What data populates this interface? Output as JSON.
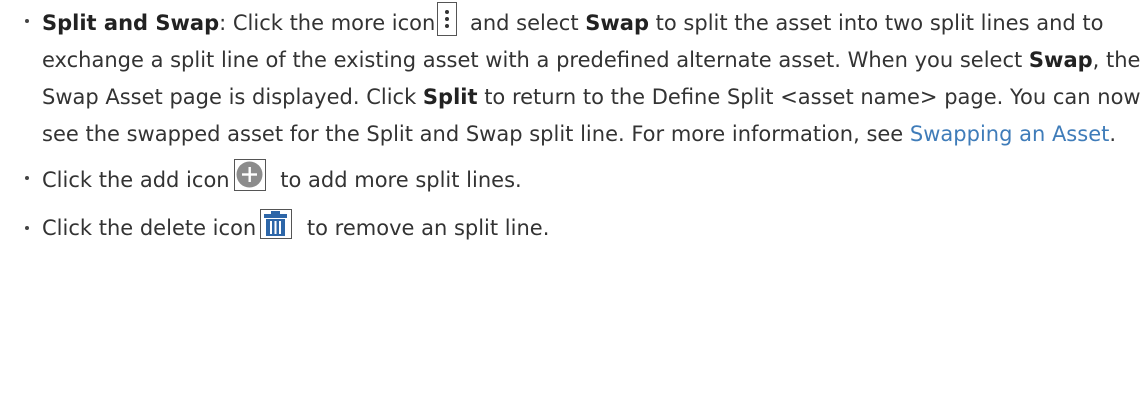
{
  "bullets": {
    "split_swap": {
      "term": "Split and Swap",
      "t1": ": Click the more icon",
      "t2": " and select ",
      "swap1": "Swap",
      "t3": " to split the asset into two split lines and to exchange a split line of the existing asset with a predefined alternate asset. When you select ",
      "swap2": "Swap",
      "t4": ", the Swap Asset page is displayed. Click ",
      "split": "Split",
      "t5": " to return to the Define Split <asset name> page. You can now see the swapped asset for the Split and Swap split line. For more information, see ",
      "link": "Swapping an Asset",
      "t6": "."
    },
    "add": {
      "t1": "Click the add icon",
      "t2": " to add more split lines."
    },
    "delete": {
      "t1": "Click the delete icon",
      "t2": " to remove an split line."
    }
  },
  "icons": {
    "more": "more-vertical-icon",
    "add": "plus-circle-icon",
    "delete": "trash-icon"
  },
  "colors": {
    "text": "#333333",
    "link": "#3f7cb9",
    "icon_gray": "#8c8c8c",
    "trash_blue": "#2d66a8"
  }
}
